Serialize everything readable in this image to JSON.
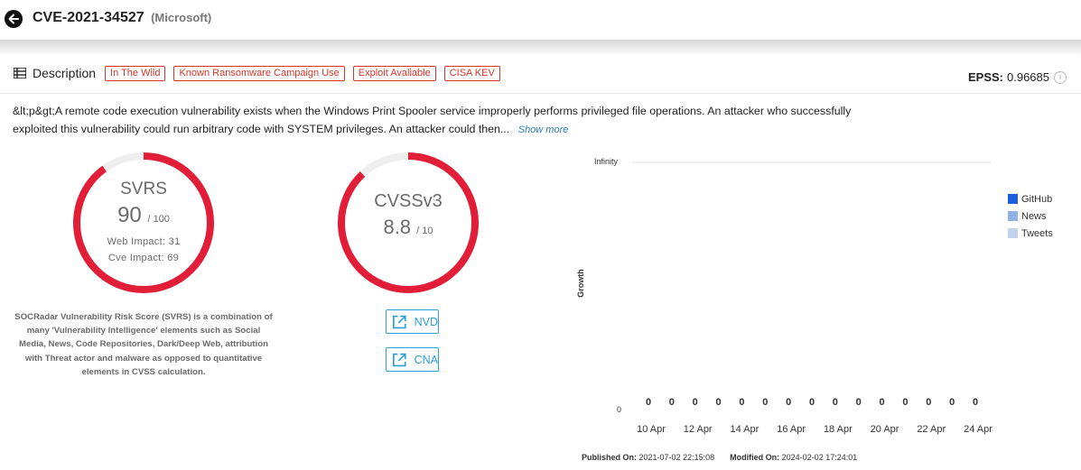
{
  "header": {
    "title": "CVE-2021-34527",
    "vendor": "(Microsoft)"
  },
  "description_section": {
    "label": "Description",
    "tags": [
      "In The Wild",
      "Known Ransomware Campaign Use",
      "Exploit Avaliable",
      "CISA KEV"
    ],
    "epss_label": "EPSS:",
    "epss_value": "0.96685",
    "text": "&lt;p&gt;A remote code execution vulnerability exists when the Windows Print Spooler service improperly performs privileged file operations. An attacker who successfully exploited this vulnerability could run arbitrary code with SYSTEM privileges. An attacker could then...",
    "show_more": "Show more"
  },
  "svrs": {
    "name": "SVRS",
    "score": "90",
    "denom": "/ 100",
    "score_fraction": 0.9,
    "web_impact": "Web Impact: 31",
    "cve_impact": "Cve Impact: 69",
    "info": "SOCRadar Vulnerability Risk Score (SVRS) is a combination of many 'Vulnerability Intelligence' elements such as Social Media, News, Code Repositories, Dark/Deep Web, attribution with Threat actor and malware as opposed to quantitative elements in CVSS calculation."
  },
  "cvss": {
    "name": "CVSSv3",
    "score": "8.8",
    "denom": "/ 10",
    "score_fraction": 0.88,
    "nvd_label": "NVD",
    "cna_label": "CNA"
  },
  "colors": {
    "gauge_red": "#e11d38",
    "gauge_track": "#eeeeee",
    "tag_red": "#d9342b",
    "link_blue": "#2a9fd8",
    "github": "#1a5fe0",
    "news": "#8fb2e6",
    "tweets": "#c2d1ec"
  },
  "chart_data": {
    "type": "bar",
    "categories": [
      "10 Apr",
      "11 Apr",
      "12 Apr",
      "13 Apr",
      "14 Apr",
      "15 Apr",
      "16 Apr",
      "17 Apr",
      "18 Apr",
      "19 Apr",
      "20 Apr",
      "21 Apr",
      "22 Apr",
      "23 Apr",
      "24 Apr"
    ],
    "x_tick_labels": [
      "10 Apr",
      "12 Apr",
      "14 Apr",
      "16 Apr",
      "18 Apr",
      "20 Apr",
      "22 Apr",
      "24 Apr"
    ],
    "series": [
      {
        "name": "GitHub",
        "values": [
          0,
          0,
          0,
          0,
          0,
          0,
          0,
          0,
          0,
          0,
          0,
          0,
          0,
          0,
          0
        ]
      },
      {
        "name": "News",
        "values": [
          0,
          0,
          0,
          0,
          0,
          0,
          0,
          0,
          0,
          0,
          0,
          0,
          0,
          0,
          0
        ]
      },
      {
        "name": "Tweets",
        "values": [
          0,
          0,
          0,
          0,
          0,
          0,
          0,
          0,
          0,
          0,
          0,
          0,
          0,
          0,
          0
        ]
      }
    ],
    "data_labels": [
      "0",
      "0",
      "0",
      "0",
      "0",
      "0",
      "0",
      "0",
      "0",
      "0",
      "0",
      "0",
      "0",
      "0",
      "0"
    ],
    "y_tick_labels": [
      "0",
      "Infinity"
    ],
    "ylabel": "Growth",
    "xlabel": "",
    "legend_position": "right",
    "grid": true
  },
  "footer": {
    "published_label": "Published On:",
    "published_value": "2021-07-02 22:15:08",
    "modified_label": "Modified On:",
    "modified_value": "2024-02-02 17:24:01"
  }
}
